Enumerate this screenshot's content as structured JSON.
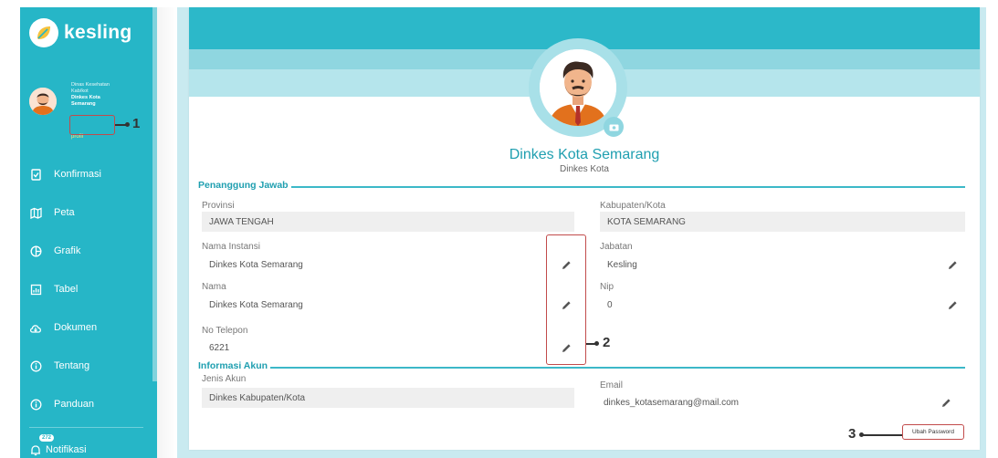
{
  "app": {
    "logo_text": "kesling"
  },
  "user": {
    "line1": "Dinas Kesehatan",
    "line2": "Kab/kot",
    "line3": "Dinkes Kota",
    "line4": "Semarang",
    "profile_link": "profil"
  },
  "menu": [
    {
      "label": "Konfirmasi",
      "icon": "confirm-icon"
    },
    {
      "label": "Peta",
      "icon": "map-icon"
    },
    {
      "label": "Grafik",
      "icon": "chart-icon"
    },
    {
      "label": "Tabel",
      "icon": "table-icon"
    },
    {
      "label": "Dokumen",
      "icon": "document-icon"
    },
    {
      "label": "Tentang",
      "icon": "info-icon"
    },
    {
      "label": "Panduan",
      "icon": "info-icon"
    }
  ],
  "notification": {
    "label": "Notifikasi",
    "count": "272"
  },
  "profile": {
    "name": "Dinkes Kota Semarang",
    "type": "Dinkes Kota"
  },
  "section_pj": {
    "title": "Penanggung Jawab"
  },
  "fields": {
    "provinsi": {
      "label": "Provinsi",
      "value": "JAWA TENGAH"
    },
    "kabkota": {
      "label": "Kabupaten/Kota",
      "value": "KOTA SEMARANG"
    },
    "instansi": {
      "label": "Nama Instansi",
      "value": "Dinkes Kota Semarang"
    },
    "jabatan": {
      "label": "Jabatan",
      "value": "Kesling"
    },
    "nama": {
      "label": "Nama",
      "value": "Dinkes Kota Semarang"
    },
    "nip": {
      "label": "Nip",
      "value": "0"
    },
    "telepon": {
      "label": "No Telepon",
      "value": "6221"
    }
  },
  "section_akun": {
    "title": "Informasi Akun"
  },
  "akun": {
    "jenis": {
      "label": "Jenis Akun",
      "value": "Dinkes Kabupaten/Kota"
    },
    "email": {
      "label": "Email",
      "value": "dinkes_kotasemarang@mail.com"
    }
  },
  "buttons": {
    "ubah_password": "Ubah Password"
  },
  "annotations": {
    "n1": "1",
    "n2": "2",
    "n3": "3"
  },
  "colors": {
    "primary": "#26b6c7",
    "annotation": "#c24b4b"
  }
}
